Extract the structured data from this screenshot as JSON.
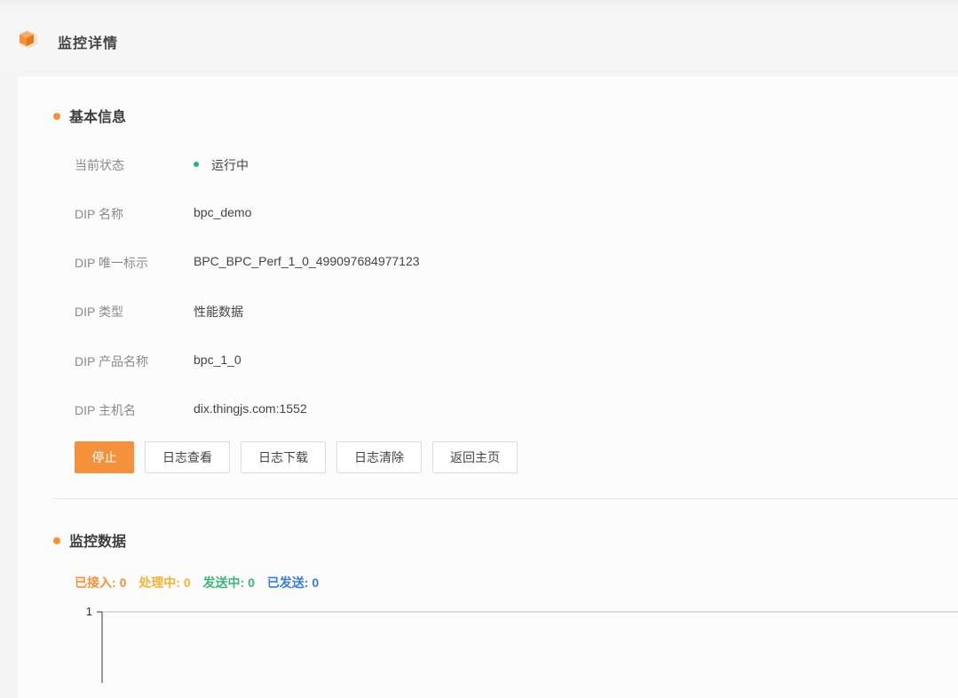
{
  "header": {
    "title": "监控详情"
  },
  "basic_info": {
    "title": "基本信息",
    "rows": [
      {
        "label": "当前状态",
        "value": "运行中"
      },
      {
        "label": "DIP 名称",
        "value": "bpc_demo"
      },
      {
        "label": "DIP 唯一标示",
        "value": "BPC_BPC_Perf_1_0_499097684977123"
      },
      {
        "label": "DIP 类型",
        "value": "性能数据"
      },
      {
        "label": "DIP 产品名称",
        "value": "bpc_1_0"
      },
      {
        "label": "DIP 主机名",
        "value": "dix.thingjs.com:1552"
      }
    ]
  },
  "actions": {
    "stop": "停止",
    "view_log": "日志查看",
    "download_log": "日志下载",
    "clear_log": "日志清除",
    "back_home": "返回主页"
  },
  "monitor": {
    "title": "监控数据",
    "stats": [
      {
        "label": "已接入:",
        "value": "0",
        "color": "#f5913a"
      },
      {
        "label": "处理中:",
        "value": "0",
        "color": "#f2b233"
      },
      {
        "label": "发送中:",
        "value": "0",
        "color": "#3cb37a"
      },
      {
        "label": "已发送:",
        "value": "0",
        "color": "#3a7bdb"
      }
    ]
  },
  "chart_data": {
    "type": "line",
    "y_tick_labels": [
      "1"
    ],
    "ylim": [
      0,
      1
    ],
    "series": []
  },
  "colors": {
    "accent": "#f5913a",
    "running": "#2fb07a"
  }
}
